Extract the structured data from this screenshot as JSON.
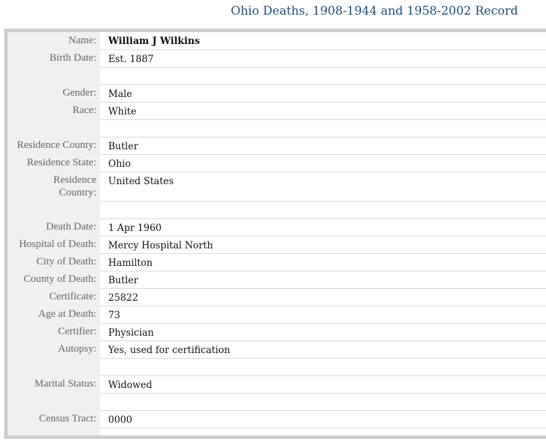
{
  "title": "Ohio Deaths, 1908-1944 and 1958-2002 Record",
  "rows": [
    {
      "label": "Name:",
      "value": "William J Wilkins"
    },
    {
      "label": "Birth Date:",
      "value": "Est. 1887"
    },
    {
      "label": "",
      "value": ""
    },
    {
      "label": "Gender:",
      "value": "Male"
    },
    {
      "label": "Race:",
      "value": "White"
    },
    {
      "label": "",
      "value": ""
    },
    {
      "label": "Residence County:",
      "value": "Butler"
    },
    {
      "label": "Residence State:",
      "value": "Ohio"
    },
    {
      "label": "Residence Country:",
      "value": "United States"
    },
    {
      "label": "",
      "value": ""
    },
    {
      "label": "Death Date:",
      "value": "1 Apr 1960"
    },
    {
      "label": "Hospital of Death:",
      "value": "Mercy Hospital North"
    },
    {
      "label": "City of Death:",
      "value": "Hamilton"
    },
    {
      "label": "County of Death:",
      "value": "Butler"
    },
    {
      "label": "Certificate:",
      "value": "25822"
    },
    {
      "label": "Age at Death:",
      "value": "73"
    },
    {
      "label": "Certifier:",
      "value": "Physician"
    },
    {
      "label": "Autopsy:",
      "value": "Yes, used for certification"
    },
    {
      "label": "",
      "value": ""
    },
    {
      "label": "Marital Status:",
      "value": "Widowed"
    },
    {
      "label": "",
      "value": ""
    },
    {
      "label": "Census Tract:",
      "value": "0000"
    }
  ]
}
